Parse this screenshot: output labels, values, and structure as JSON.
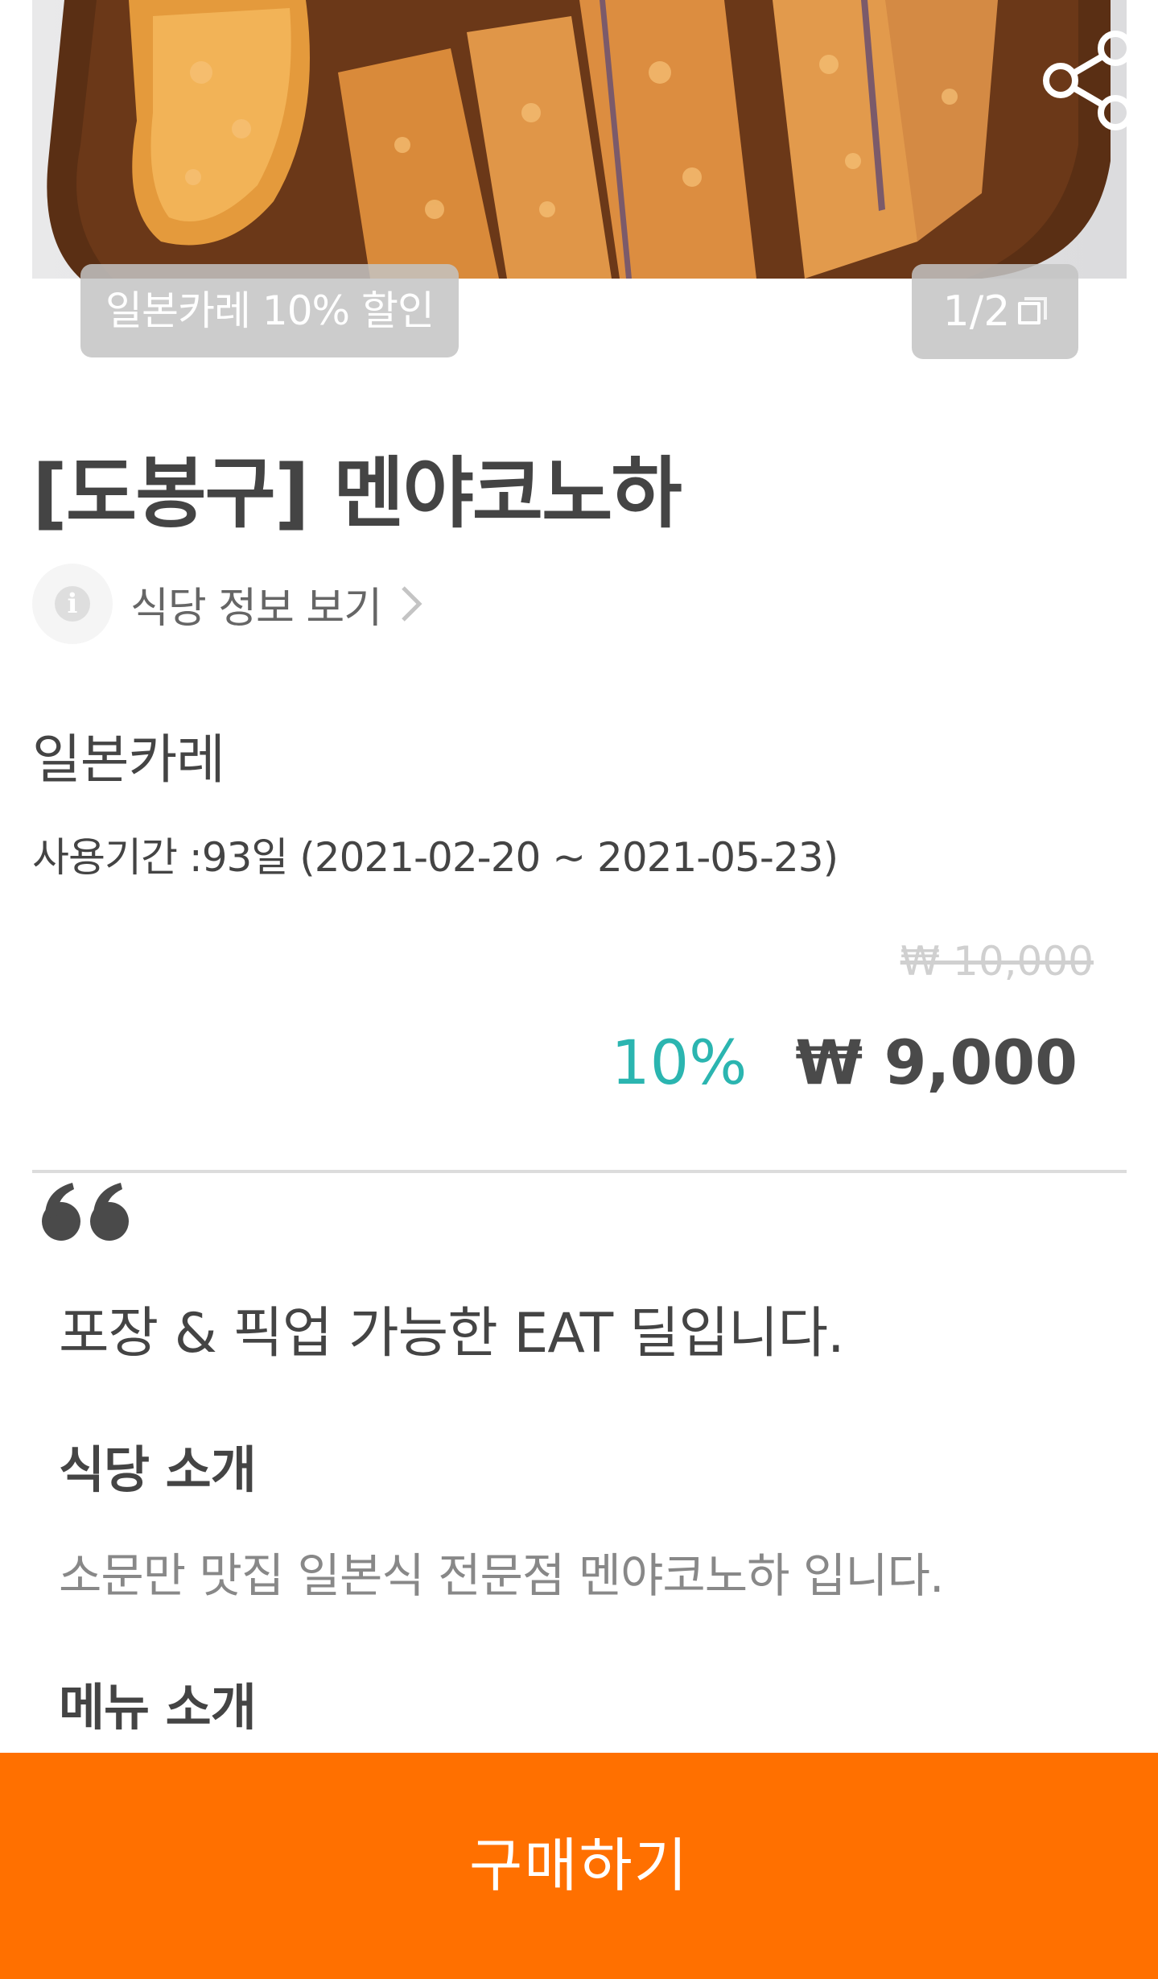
{
  "hero": {
    "tag": "일본카레 10% 할인",
    "counter": "1/2",
    "share_icon": "share-icon",
    "gallery_icon": "gallery-icon"
  },
  "restaurant": {
    "title": "[도봉구] 멘야코노하",
    "info_link": "식당 정보 보기",
    "info_icon": "info-icon"
  },
  "deal": {
    "category": "일본카레",
    "period": "사용기간 :93일 (2021-02-20 ~ 2021-05-23)",
    "original_price": "₩ 10,000",
    "discount": "10%",
    "price": "₩ 9,000"
  },
  "description": {
    "promo": "포장 & 픽업 가능한 EAT 딜입니다.",
    "intro_title": "식당 소개",
    "intro_body": "소문만 맛집 일본식 전문점 멘야코노하 입니다.",
    "menu_title": "메뉴 소개"
  },
  "footer": {
    "buy_label": "구매하기"
  },
  "colors": {
    "accent": "#ff7000",
    "discount": "#2bb5b0",
    "text": "#444444"
  }
}
